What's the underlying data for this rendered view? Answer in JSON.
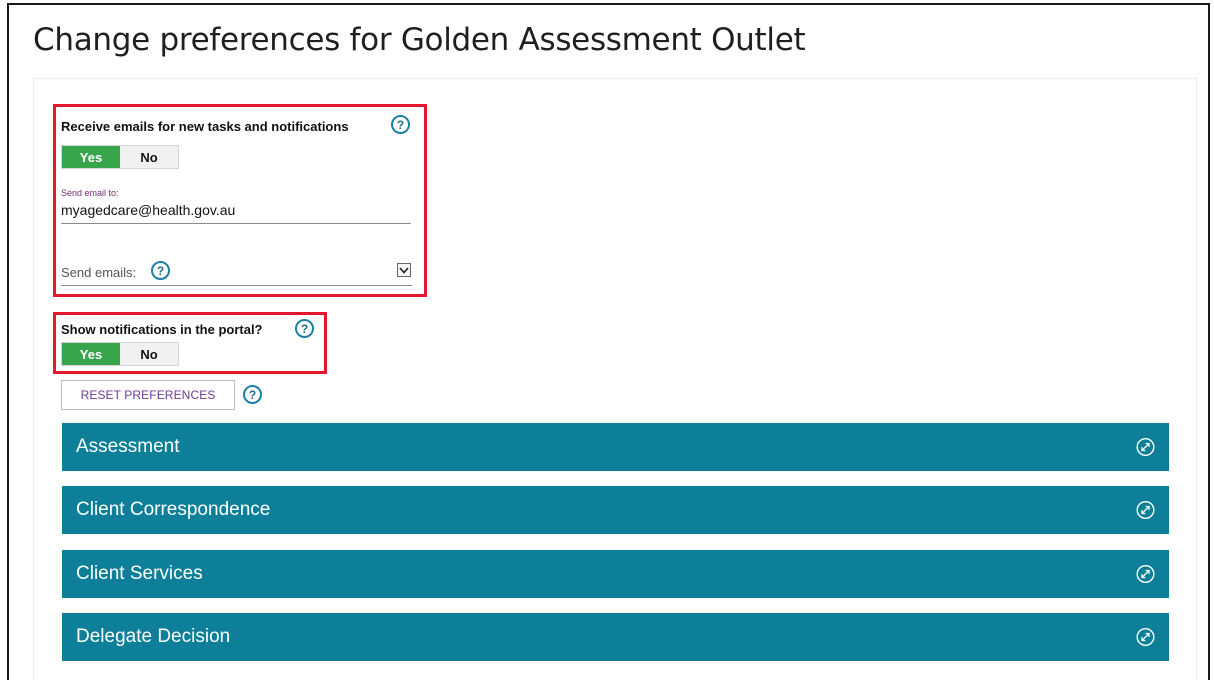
{
  "page": {
    "title": "Change preferences for Golden Assessment Outlet"
  },
  "email_prefs": {
    "question": "Receive emails for new tasks and notifications",
    "toggle": {
      "yes": "Yes",
      "no": "No",
      "selected": "Yes"
    },
    "send_to_label": "Send email to:",
    "send_to_value": "myagedcare@health.gov.au",
    "send_emails_label": "Send emails:"
  },
  "portal_prefs": {
    "question": "Show notifications in the portal?",
    "toggle": {
      "yes": "Yes",
      "no": "No",
      "selected": "Yes"
    }
  },
  "reset": {
    "label": "RESET PREFERENCES"
  },
  "help_glyph": "?",
  "sections": [
    {
      "label": "Assessment"
    },
    {
      "label": "Client Correspondence"
    },
    {
      "label": "Client Services"
    },
    {
      "label": "Delegate Decision"
    }
  ],
  "colors": {
    "accent_teal": "#0e7f99",
    "toggle_on": "#38a54c",
    "highlight_red": "#e3182d",
    "help_blue": "#1b80a4"
  },
  "icons": {
    "help": "question-circle-icon",
    "expand": "expand-arrows-icon",
    "dropdown": "chevron-down-icon"
  }
}
